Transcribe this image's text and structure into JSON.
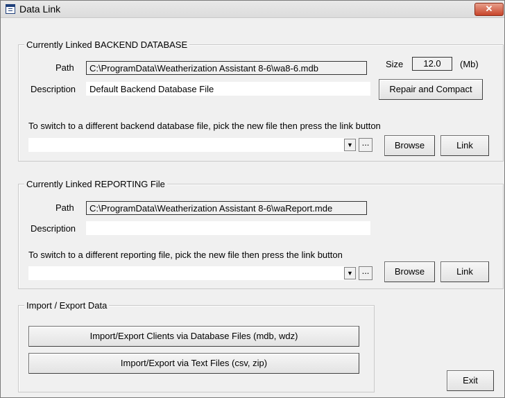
{
  "window": {
    "title": "Data Link",
    "close_glyph": "✕"
  },
  "backend": {
    "legend": "Currently Linked BACKEND DATABASE",
    "path_label": "Path",
    "path_value": "C:\\ProgramData\\Weatherization Assistant 8-6\\wa8-6.mdb",
    "size_label": "Size",
    "size_value": "12.0",
    "size_unit": "(Mb)",
    "description_label": "Description",
    "description_value": "Default Backend Database File",
    "repair_button": "Repair and Compact",
    "instruction": "To switch to a different backend database file, pick the new file then press the link button",
    "picker_value": "",
    "picker_arrow": "▼",
    "picker_dots": "...",
    "browse_button": "Browse",
    "link_button": "Link"
  },
  "reporting": {
    "legend": "Currently Linked REPORTING File",
    "path_label": "Path",
    "path_value": "C:\\ProgramData\\Weatherization Assistant 8-6\\waReport.mde",
    "description_label": "Description",
    "description_value": "",
    "instruction": "To switch to a different reporting file, pick the new file then press the link button",
    "picker_value": "",
    "picker_arrow": "▼",
    "picker_dots": "...",
    "browse_button": "Browse",
    "link_button": "Link"
  },
  "import_export": {
    "legend": "Import / Export Data",
    "db_files_button": "Import/Export Clients via Database Files (mdb, wdz)",
    "text_files_button": "Import/Export via Text Files (csv, zip)"
  },
  "exit_button": "Exit",
  "icons": {
    "window_icon": "form-icon",
    "close_icon": "close-icon",
    "dropdown_icon": "chevron-down-icon",
    "ellipsis_icon": "ellipsis-icon"
  }
}
